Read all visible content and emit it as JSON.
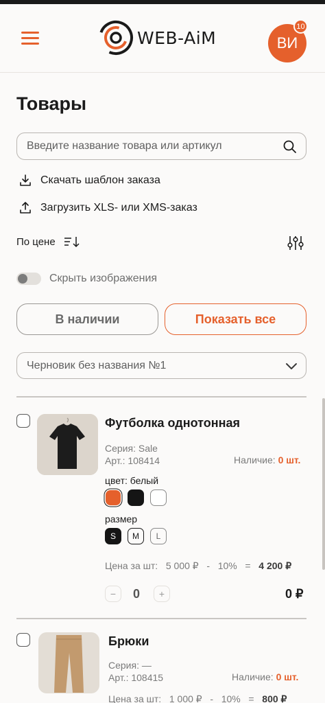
{
  "header": {
    "logo_text": "WEB-AiM",
    "avatar_initials": "ВИ",
    "notification_count": "10"
  },
  "page": {
    "title": "Товары",
    "search_placeholder": "Введите название товара или артикул",
    "download_template_label": "Скачать шаблон заказа",
    "upload_order_label": "Загрузить XLS- или XMS-заказ",
    "sort_label": "По цене",
    "hide_images_label": "Скрыть изображения",
    "hide_images_on": false,
    "in_stock_button": "В наличии",
    "show_all_button": "Показать все",
    "draft_select_value": "Черновик без названия №1"
  },
  "colors": {
    "accent": "#e5602c",
    "swatch_orange": "#e5602c",
    "swatch_black": "#151515",
    "swatch_white": "#ffffff"
  },
  "products": [
    {
      "title": "Футболка однотонная",
      "series": "Серия: Sale",
      "sku": "Арт.: 108414",
      "stock_label": "Наличие:",
      "stock_value": "0 шт.",
      "color_label": "цвет: белый",
      "sizes_label": "размер",
      "sizes": [
        "S",
        "M",
        "L"
      ],
      "selected_size": "S",
      "price_label": "Цена за шт:",
      "price": "5 000 ₽",
      "dash": "-",
      "discount": "10%",
      "equals": "=",
      "price_final": "4 200 ₽",
      "quantity": "0",
      "total": "0 ₽",
      "minus": "−",
      "plus": "+"
    },
    {
      "title": "Брюки",
      "series": "Серия: —",
      "sku": "Арт.: 108415",
      "stock_label": "Наличие:",
      "stock_value": "0 шт.",
      "price_label": "Цена за шт:",
      "price": "1 000 ₽",
      "dash": "-",
      "discount": "10%",
      "equals": "=",
      "price_final": "800 ₽"
    }
  ]
}
